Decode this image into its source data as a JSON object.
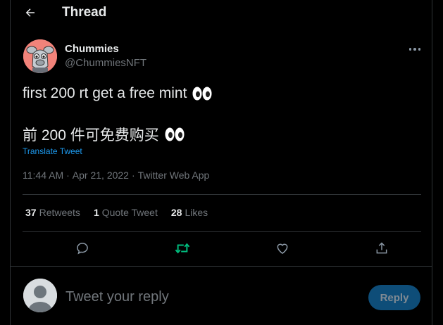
{
  "header": {
    "title": "Thread"
  },
  "author": {
    "name": "Chummies",
    "handle": "@ChummiesNFT"
  },
  "tweet": {
    "line1": "first 200 rt get a free mint",
    "line2": "前 200 件可免费购买",
    "emoji": "👀",
    "translate": "Translate Tweet",
    "time": "11:44 AM",
    "sep": "·",
    "date": "Apr 21, 2022",
    "source": "Twitter Web App"
  },
  "stats": {
    "retweets": {
      "count": "37",
      "label": "Retweets"
    },
    "quotes": {
      "count": "1",
      "label": "Quote Tweet"
    },
    "likes": {
      "count": "28",
      "label": "Likes"
    }
  },
  "composer": {
    "placeholder": "Tweet your reply",
    "button": "Reply"
  },
  "colors": {
    "background": "#000000",
    "link": "#1d9bf0",
    "retweet_active": "#00ba7c",
    "muted": "#71767b",
    "reply_button_disabled": "#0e4d78"
  },
  "icons": [
    "back-arrow-icon",
    "more-icon",
    "reply-icon",
    "retweet-icon",
    "like-icon",
    "share-icon",
    "eyes-emoji"
  ]
}
